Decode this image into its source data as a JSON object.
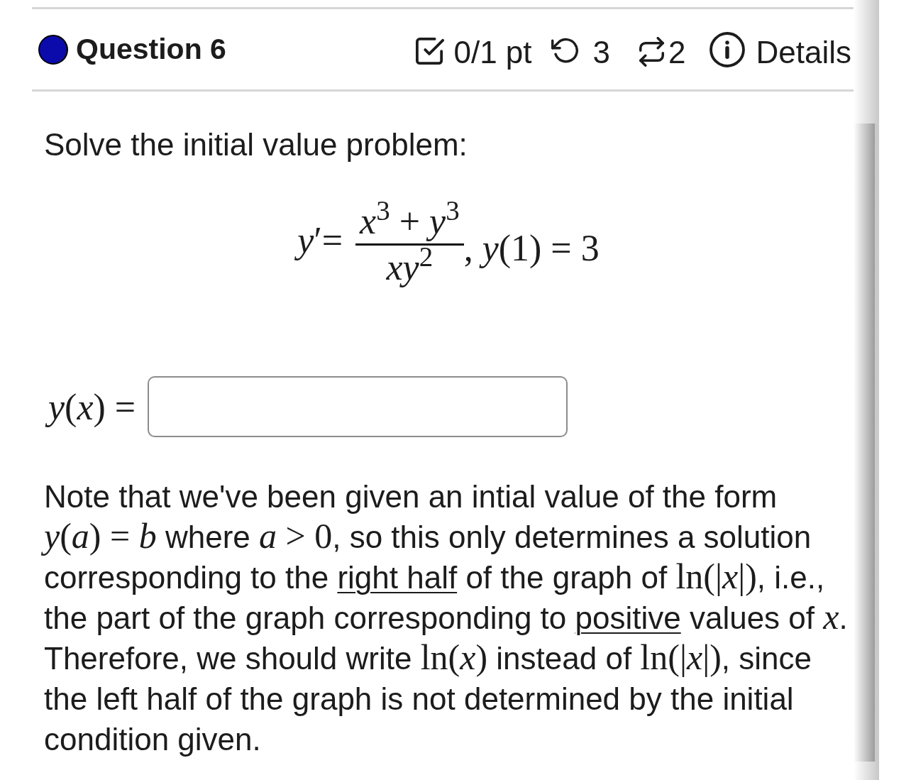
{
  "header": {
    "title": "Question 6",
    "score": "0/1 pt",
    "attempts": "3",
    "retries": "2",
    "details": "Details"
  },
  "prompt": "Solve the initial value problem:",
  "equation": {
    "lhs": "*y*′=",
    "numerator": "*x*$^{3}$ + *y*$^{3}$",
    "denominator": "*xy*$^{2}$",
    "condition": ", *y*(1) = 3"
  },
  "answer": {
    "label": "*y*(*x*) ="
  },
  "note": {
    "parts": [
      {
        "kind": "text",
        "text": "Note that we've been given an intial value of the form "
      },
      {
        "kind": "math",
        "text": "*y*(*a*) = *b*"
      },
      {
        "kind": "text",
        "text": " where "
      },
      {
        "kind": "math",
        "text": "*a* > 0"
      },
      {
        "kind": "text",
        "text": ", so this only determines a solution corresponding to the "
      },
      {
        "kind": "link",
        "text": "right half"
      },
      {
        "kind": "text",
        "text": " of the graph of "
      },
      {
        "kind": "math",
        "text": "ln(|*x*|)"
      },
      {
        "kind": "text",
        "text": ", i.e., the part of the graph corresponding to "
      },
      {
        "kind": "link",
        "text": "positive"
      },
      {
        "kind": "text",
        "text": " values of "
      },
      {
        "kind": "math",
        "text": "*x*"
      },
      {
        "kind": "text",
        "text": ". Therefore, we should write "
      },
      {
        "kind": "math",
        "text": "ln(*x*)"
      },
      {
        "kind": "text",
        "text": " instead of "
      },
      {
        "kind": "math",
        "text": "ln(|*x*|)"
      },
      {
        "kind": "text",
        "text": ", since the left half of the graph is not determined by the initial condition given."
      }
    ]
  }
}
